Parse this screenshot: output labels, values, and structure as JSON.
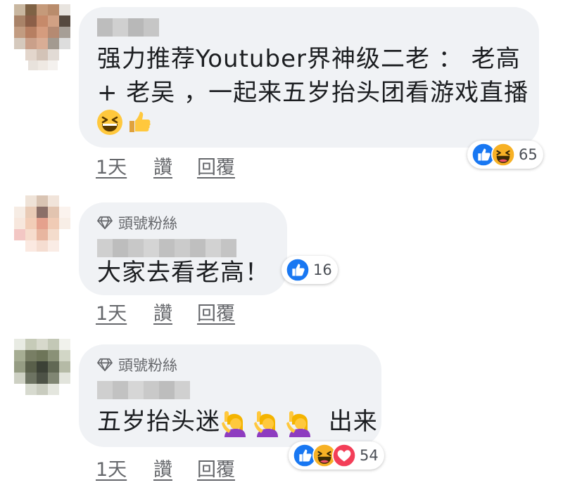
{
  "comments": [
    {
      "text_line1": "强力推荐Youtuber界神级二老 ： 老高",
      "text_line2": "+ 老吴 ，一起来五岁抬头团看游戏直播",
      "emoji": [
        "grinning-squinting-face",
        "thumbs-up"
      ],
      "actions": {
        "time": "1天",
        "like": "讚",
        "reply": "回覆"
      },
      "reactions": {
        "icons": [
          "like",
          "haha"
        ],
        "count": "65"
      }
    },
    {
      "badge": "頭號粉絲",
      "text": "大家去看老高！",
      "actions": {
        "time": "1天",
        "like": "讚",
        "reply": "回覆"
      },
      "reactions": {
        "icons": [
          "like"
        ],
        "count": "16"
      }
    },
    {
      "badge": "頭號粉絲",
      "text_before": "五岁抬头迷",
      "emoji": [
        "person-raising-hand",
        "person-raising-hand",
        "person-raising-hand"
      ],
      "text_after": "出来",
      "actions": {
        "time": "1天",
        "like": "讚",
        "reply": "回覆"
      },
      "reactions": {
        "icons": [
          "like",
          "haha",
          "love"
        ],
        "count": "54"
      }
    }
  ],
  "colors": {
    "bubble": "#f0f2f5",
    "like": "#1877f2",
    "haha": "#f7b125",
    "love": "#f33e58",
    "meta": "#65676b"
  }
}
